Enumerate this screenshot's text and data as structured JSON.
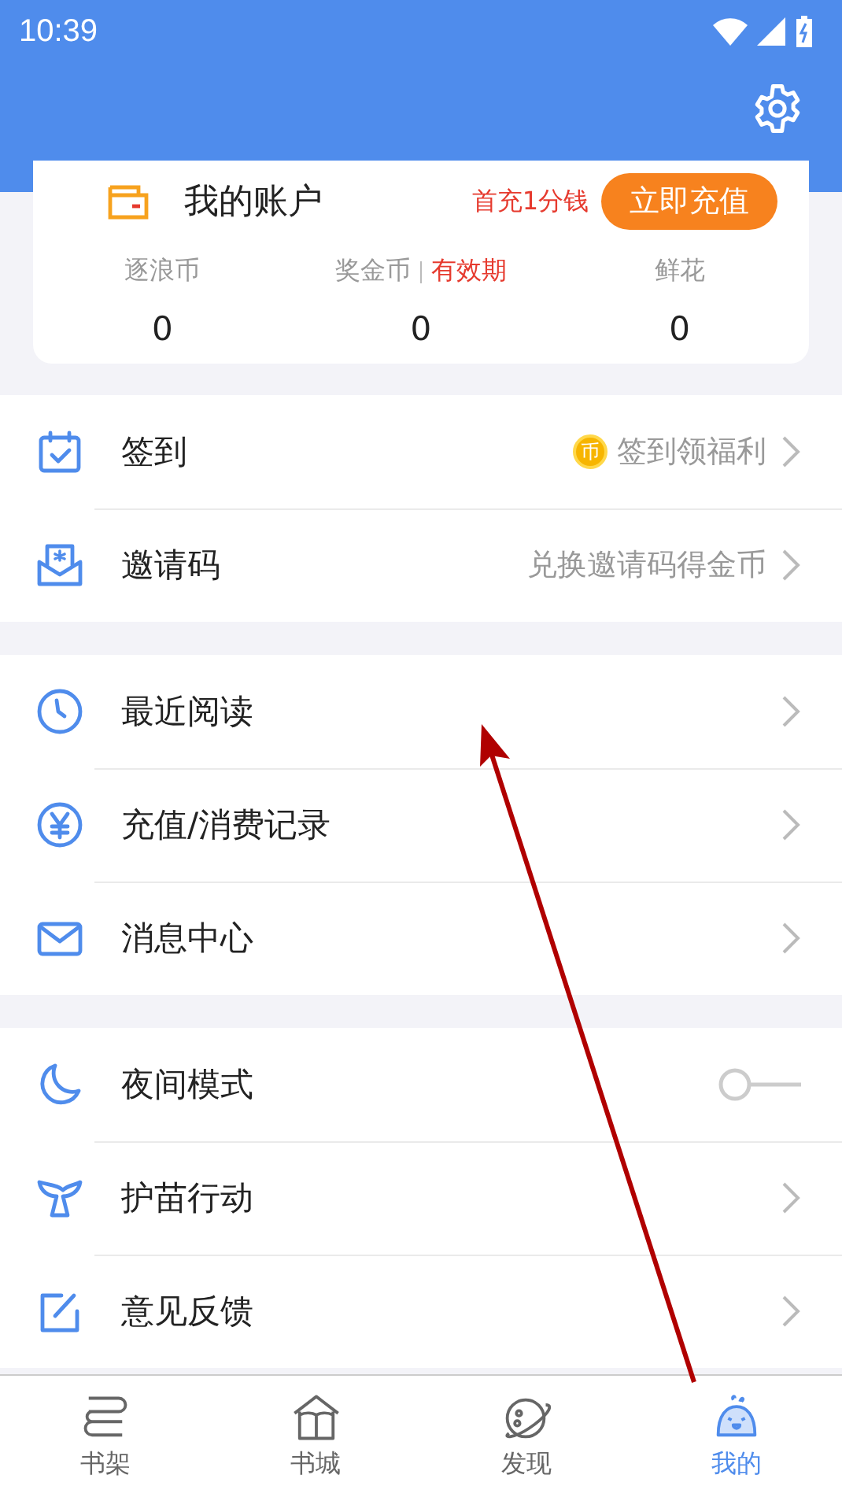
{
  "status_bar": {
    "time": "10:39"
  },
  "account": {
    "title": "我的账户",
    "promo": "首充1分钱",
    "button": "立即充值",
    "stats": [
      {
        "label": "逐浪币",
        "value": "0"
      },
      {
        "label": "奖金币",
        "extra": "有效期",
        "value": "0"
      },
      {
        "label": "鲜花",
        "value": "0"
      }
    ]
  },
  "sections": [
    {
      "items": [
        {
          "kind": "link",
          "label": "签到",
          "coin": "币",
          "hint": "签到领福利"
        },
        {
          "kind": "link",
          "label": "邀请码",
          "hint": "兑换邀请码得金币"
        }
      ]
    },
    {
      "items": [
        {
          "kind": "link",
          "label": "最近阅读"
        },
        {
          "kind": "link",
          "label": "充值/消费记录"
        },
        {
          "kind": "link",
          "label": "消息中心"
        }
      ]
    },
    {
      "items": [
        {
          "kind": "toggle",
          "label": "夜间模式",
          "on": false
        },
        {
          "kind": "link",
          "label": "护苗行动"
        },
        {
          "kind": "link",
          "label": "意见反馈"
        }
      ]
    }
  ],
  "tabs": [
    {
      "label": "书架",
      "selected": false
    },
    {
      "label": "书城",
      "selected": false
    },
    {
      "label": "发现",
      "selected": false
    },
    {
      "label": "我的",
      "selected": true
    }
  ]
}
